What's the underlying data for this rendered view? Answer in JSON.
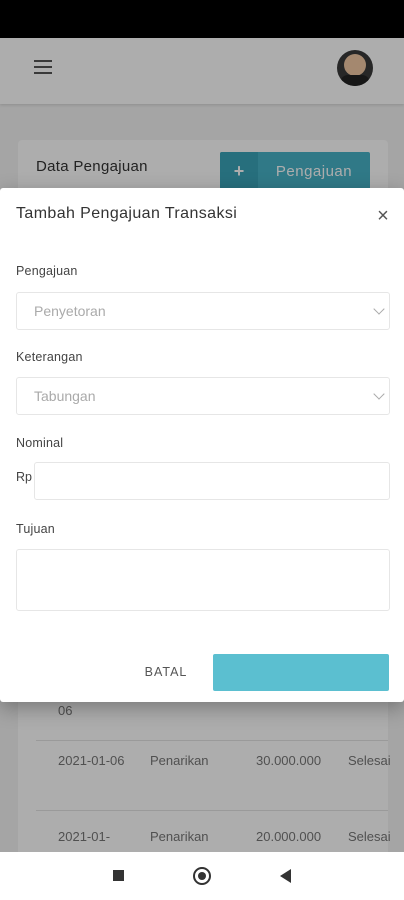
{
  "app": {
    "card_title": "Data Pengajuan",
    "add_button_icon": "+",
    "add_button_label": "Pengajuan"
  },
  "table": {
    "rows": [
      {
        "date": "06",
        "type": "",
        "amount": "",
        "status": ""
      },
      {
        "date": "2021-01-06",
        "type": "Penarikan",
        "amount": "30.000.000",
        "status": "Selesai"
      },
      {
        "date": "2021-01-",
        "type": "Penarikan",
        "amount": "20.000.000",
        "status": "Selesai"
      }
    ]
  },
  "modal": {
    "title": "Tambah Pengajuan Transaksi",
    "close_icon": "×",
    "fields": {
      "pengajuan": {
        "label": "Pengajuan",
        "value": "Penyetoran"
      },
      "keterangan": {
        "label": "Keterangan",
        "value": "Tabungan"
      },
      "nominal": {
        "label": "Nominal",
        "prefix": "Rp",
        "value": ""
      },
      "tujuan": {
        "label": "Tujuan",
        "value": ""
      }
    },
    "cancel_label": "BATAL",
    "submit_label": ""
  },
  "colors": {
    "accent": "#48b3c7",
    "submit": "#5bbfd0"
  },
  "icons": {
    "menu": "hamburger-menu-icon",
    "close": "close-icon",
    "chevron": "chevron-down-icon"
  }
}
